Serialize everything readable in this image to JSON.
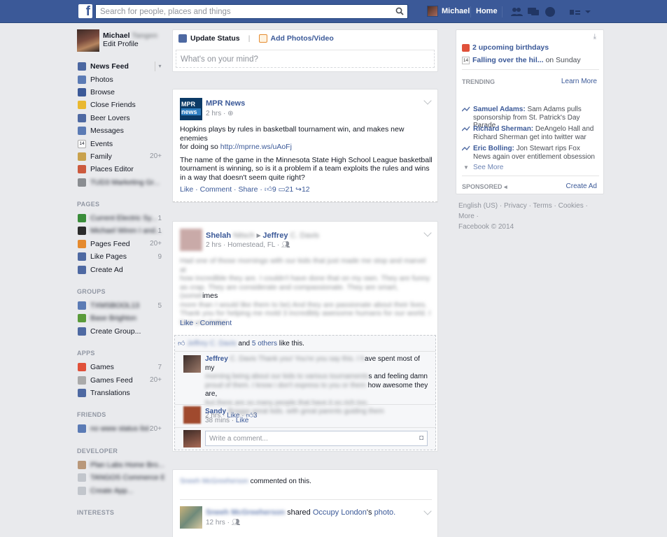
{
  "topbar": {
    "search_placeholder": "Search for people, places and things",
    "user_name": "Michael",
    "home_label": "Home"
  },
  "profile": {
    "name": "Michael",
    "name_blurred": "Tangen",
    "edit_label": "Edit Profile"
  },
  "nav": {
    "favorites": [
      {
        "label": "News Feed",
        "icon": "news-feed-icon",
        "color": "#4b67a1",
        "selected": true
      },
      {
        "label": "Photos",
        "icon": "photos-icon",
        "color": "#5b7bb5"
      },
      {
        "label": "Browse",
        "icon": "browse-icon",
        "color": "#3b5998"
      },
      {
        "label": "Close Friends",
        "icon": "star-icon",
        "color": "#e9b830"
      },
      {
        "label": "Beer Lovers",
        "icon": "list-icon",
        "color": "#4e69a2"
      },
      {
        "label": "Messages",
        "icon": "messages-icon",
        "color": "#5b7bb5"
      },
      {
        "label": "Events",
        "icon": "calendar-icon",
        "color": "#d8d8d8",
        "badge": "14"
      },
      {
        "label": "Family",
        "icon": "family-icon",
        "color": "#c9a24d",
        "count": "20+"
      },
      {
        "label": "Places Editor",
        "icon": "places-icon",
        "color": "#cc5a3e"
      },
      {
        "label": "TUD3 Marketing Gr...",
        "icon": "group-icon",
        "color": "#8a8d91",
        "blurred": true
      }
    ],
    "pages_title": "PAGES",
    "pages": [
      {
        "label": "Current Electric Sy...",
        "icon": "page-u-icon",
        "color": "#3a8d3a",
        "blurred": true,
        "count": "1"
      },
      {
        "label": "Michael Wiren I and...",
        "icon": "page-dark-icon",
        "color": "#2c2c2c",
        "blurred": true,
        "count": "1"
      },
      {
        "label": "Pages Feed",
        "icon": "megaphone-icon",
        "color": "#e58a2e",
        "count": "20+"
      },
      {
        "label": "Like Pages",
        "icon": "like-icon",
        "color": "#4e69a2",
        "count": "9"
      },
      {
        "label": "Create Ad",
        "icon": "chart-icon",
        "color": "#4e69a2"
      }
    ],
    "groups_title": "GROUPS",
    "groups": [
      {
        "label": "TXMSBOOL13",
        "icon": "group-icon",
        "color": "#5b7bb5",
        "blurred": true,
        "count": "5"
      },
      {
        "label": "Base Brighton",
        "icon": "tree-icon",
        "color": "#5a9b3a",
        "blurred": true
      },
      {
        "label": "Create Group...",
        "icon": "plus-icon",
        "color": "#4e69a2"
      }
    ],
    "apps_title": "APPS",
    "apps": [
      {
        "label": "Games",
        "icon": "games-icon",
        "color": "#e0513a",
        "count": "7"
      },
      {
        "label": "Games Feed",
        "icon": "gamepad-icon",
        "color": "#aaaaaa",
        "count": "20+"
      },
      {
        "label": "Translations",
        "icon": "translations-icon",
        "color": "#4e69a2"
      }
    ],
    "friends_title": "FRIENDS",
    "friends": [
      {
        "label": "no www status list",
        "icon": "friends-icon",
        "color": "#5b7bb5",
        "blurred": true,
        "count": "20+"
      }
    ],
    "developer_title": "DEVELOPER",
    "developer": [
      {
        "label": "Plan Labs Home Bro...",
        "icon": "app-icon",
        "color": "#b9987a",
        "blurred": true
      },
      {
        "label": "TANGOS Commerce Ev...",
        "icon": "app-icon",
        "color": "#c2c6cc",
        "blurred": true
      },
      {
        "label": "Create App...",
        "icon": "app-icon",
        "color": "#c2c6cc",
        "blurred": true
      }
    ],
    "interests_title": "INTERESTS"
  },
  "composer": {
    "update_status": "Update Status",
    "add_photos": "Add Photos/Video",
    "placeholder": "What's on your mind?"
  },
  "post1": {
    "author": "MPR News",
    "logo_top": "MPR",
    "logo_bottom": "news",
    "time": "2 hrs ·",
    "text1a": "Hopkins plays by rules in basketball tournament win, and makes new enemies",
    "text1b_prefix": "for doing so",
    "link": "http://mprne.ws/uAoFj",
    "text2a": "The name of the game in the Minnesota State High School League basketball",
    "text2b": "tournament is winning, so is it a problem if a team exploits the rules and wins",
    "text2c": "in a way that doesn't seem quite right?",
    "like": "Like",
    "comment": "Comment",
    "share": "Share",
    "likes": "9",
    "comments": "21",
    "shares": "12"
  },
  "post2": {
    "author": "Shelah",
    "author_blurred": "Nitsch",
    "arrow": "▸",
    "target": "Jeffrey",
    "target_blurred": "C. Davis",
    "meta": "2 hrs · Homestead, FL ·",
    "blurred_lines": [
      "Had one of those mornings with our kids that just made me stop and marvel at",
      "how incredible they are. I couldn't have done that on my own. They are funny",
      "as crap. They are considerate and compassionate. They are smart, (somet",
      "more than I would like them to be) And they are passionate about their lives.",
      "Thank you for helping me mold 3 incredibly awesome humans for our world. I",
      "love you baby!"
    ],
    "line3_visible_end": "imes",
    "like": "Like",
    "comment": "Comment",
    "likers_blurred": "Jeffrey C. Davis",
    "likers_rest": "and",
    "others": "5 others",
    "like_this": "like this.",
    "reply1_author": "Jeffrey",
    "reply1_author_blurred": "C. Davis",
    "reply1_b1": "Thank you! You're you say this. I h",
    "reply1_v1": "ave spent most of my",
    "reply1_b2": "morning being about our kids to various tournaments",
    "reply1_v2": "s and feeling damn",
    "reply1_b3": "proud of them. I know i don't express to you or them",
    "reply1_v3": "how awesome they are,",
    "reply1_b4": "but there are so many people that have it so rich too.",
    "reply1_meta": "2 hrs ·",
    "reply1_like": "Like",
    "reply1_likes": "3",
    "reply2_author": "Sandy",
    "reply2_author_blurred": "Braggs",
    "reply2_text_blurred": "great kids. with great parents guiding them",
    "reply2_meta": "38 mins ·",
    "reply2_like": "Like",
    "write_comment": "Write a comment..."
  },
  "post3": {
    "commenter_blurred": "Sneeh McGreeherson",
    "commented": "commented on this.",
    "sharer_blurred": "Sneeh McGreeherson",
    "shared": "shared",
    "shared_from": "Occupy London",
    "shared_suffix": "'s",
    "photo": "photo.",
    "meta": "12 hrs ·"
  },
  "right": {
    "birthdays": "2 upcoming birthdays",
    "event_title": "Falling over the hil...",
    "event_when": "on Sunday",
    "event_badge": "14",
    "trending_label": "TRENDING",
    "learn_more": "Learn More",
    "trends": [
      {
        "name": "Samuel Adams:",
        "desc": "Sam Adams pulls sponsorship from St. Patrick's Day Parade"
      },
      {
        "name": "Richard Sherman:",
        "desc": "DeAngelo Hall and Richard Sherman get into twitter war"
      },
      {
        "name": "Eric Bolling:",
        "desc": "Jon Stewart rips Fox News again over entitlement obsession"
      }
    ],
    "see_more": "See More",
    "sponsored": "SPONSORED",
    "create_ad": "Create Ad"
  },
  "footer": {
    "line1": "English (US) · Privacy · Terms · Cookies · More ·",
    "line2": "Facebook © 2014"
  }
}
